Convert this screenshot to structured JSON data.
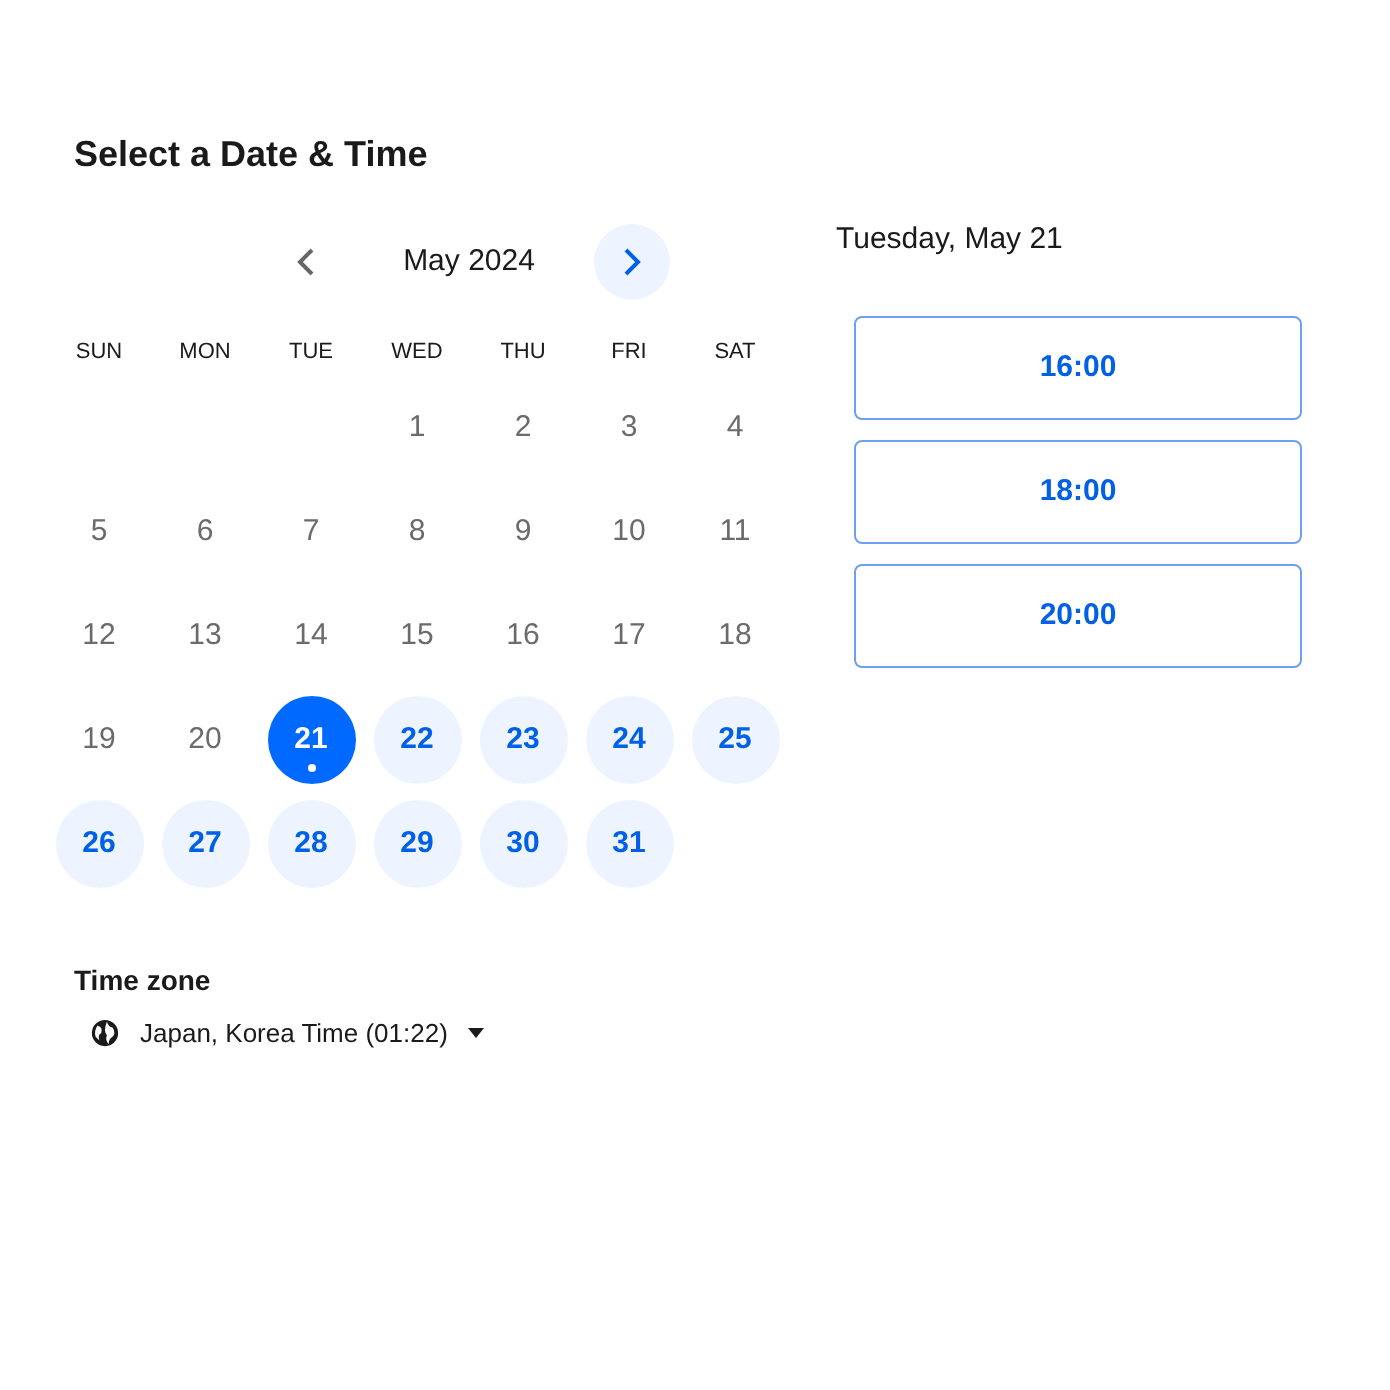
{
  "title": "Select a Date & Time",
  "calendar": {
    "month": "May 2024",
    "weekdays": [
      "SUN",
      "MON",
      "TUE",
      "WED",
      "THU",
      "FRI",
      "SAT"
    ],
    "weeks": [
      [
        {
          "kind": "blank"
        },
        {
          "kind": "blank"
        },
        {
          "kind": "blank"
        },
        {
          "kind": "day",
          "day": "1",
          "available": false,
          "selected": false
        },
        {
          "kind": "day",
          "day": "2",
          "available": false,
          "selected": false
        },
        {
          "kind": "day",
          "day": "3",
          "available": false,
          "selected": false
        },
        {
          "kind": "day",
          "day": "4",
          "available": false,
          "selected": false
        }
      ],
      [
        {
          "kind": "day",
          "day": "5",
          "available": false,
          "selected": false
        },
        {
          "kind": "day",
          "day": "6",
          "available": false,
          "selected": false
        },
        {
          "kind": "day",
          "day": "7",
          "available": false,
          "selected": false
        },
        {
          "kind": "day",
          "day": "8",
          "available": false,
          "selected": false
        },
        {
          "kind": "day",
          "day": "9",
          "available": false,
          "selected": false
        },
        {
          "kind": "day",
          "day": "10",
          "available": false,
          "selected": false
        },
        {
          "kind": "day",
          "day": "11",
          "available": false,
          "selected": false
        }
      ],
      [
        {
          "kind": "day",
          "day": "12",
          "available": false,
          "selected": false
        },
        {
          "kind": "day",
          "day": "13",
          "available": false,
          "selected": false
        },
        {
          "kind": "day",
          "day": "14",
          "available": false,
          "selected": false
        },
        {
          "kind": "day",
          "day": "15",
          "available": false,
          "selected": false
        },
        {
          "kind": "day",
          "day": "16",
          "available": false,
          "selected": false
        },
        {
          "kind": "day",
          "day": "17",
          "available": false,
          "selected": false
        },
        {
          "kind": "day",
          "day": "18",
          "available": false,
          "selected": false
        }
      ],
      [
        {
          "kind": "day",
          "day": "19",
          "available": false,
          "selected": false
        },
        {
          "kind": "day",
          "day": "20",
          "available": false,
          "selected": false
        },
        {
          "kind": "day",
          "day": "21",
          "available": true,
          "selected": true
        },
        {
          "kind": "day",
          "day": "22",
          "available": true,
          "selected": false
        },
        {
          "kind": "day",
          "day": "23",
          "available": true,
          "selected": false
        },
        {
          "kind": "day",
          "day": "24",
          "available": true,
          "selected": false
        },
        {
          "kind": "day",
          "day": "25",
          "available": true,
          "selected": false
        }
      ],
      [
        {
          "kind": "day",
          "day": "26",
          "available": true,
          "selected": false
        },
        {
          "kind": "day",
          "day": "27",
          "available": true,
          "selected": false
        },
        {
          "kind": "day",
          "day": "28",
          "available": true,
          "selected": false
        },
        {
          "kind": "day",
          "day": "29",
          "available": true,
          "selected": false
        },
        {
          "kind": "day",
          "day": "30",
          "available": true,
          "selected": false
        },
        {
          "kind": "day",
          "day": "31",
          "available": true,
          "selected": false
        }
      ]
    ]
  },
  "time_zone": {
    "label": "Time zone",
    "value": "Japan, Korea Time (01:22)"
  },
  "selected_date": "Tuesday, May 21",
  "time_slots": [
    "16:00",
    "18:00",
    "20:00"
  ]
}
